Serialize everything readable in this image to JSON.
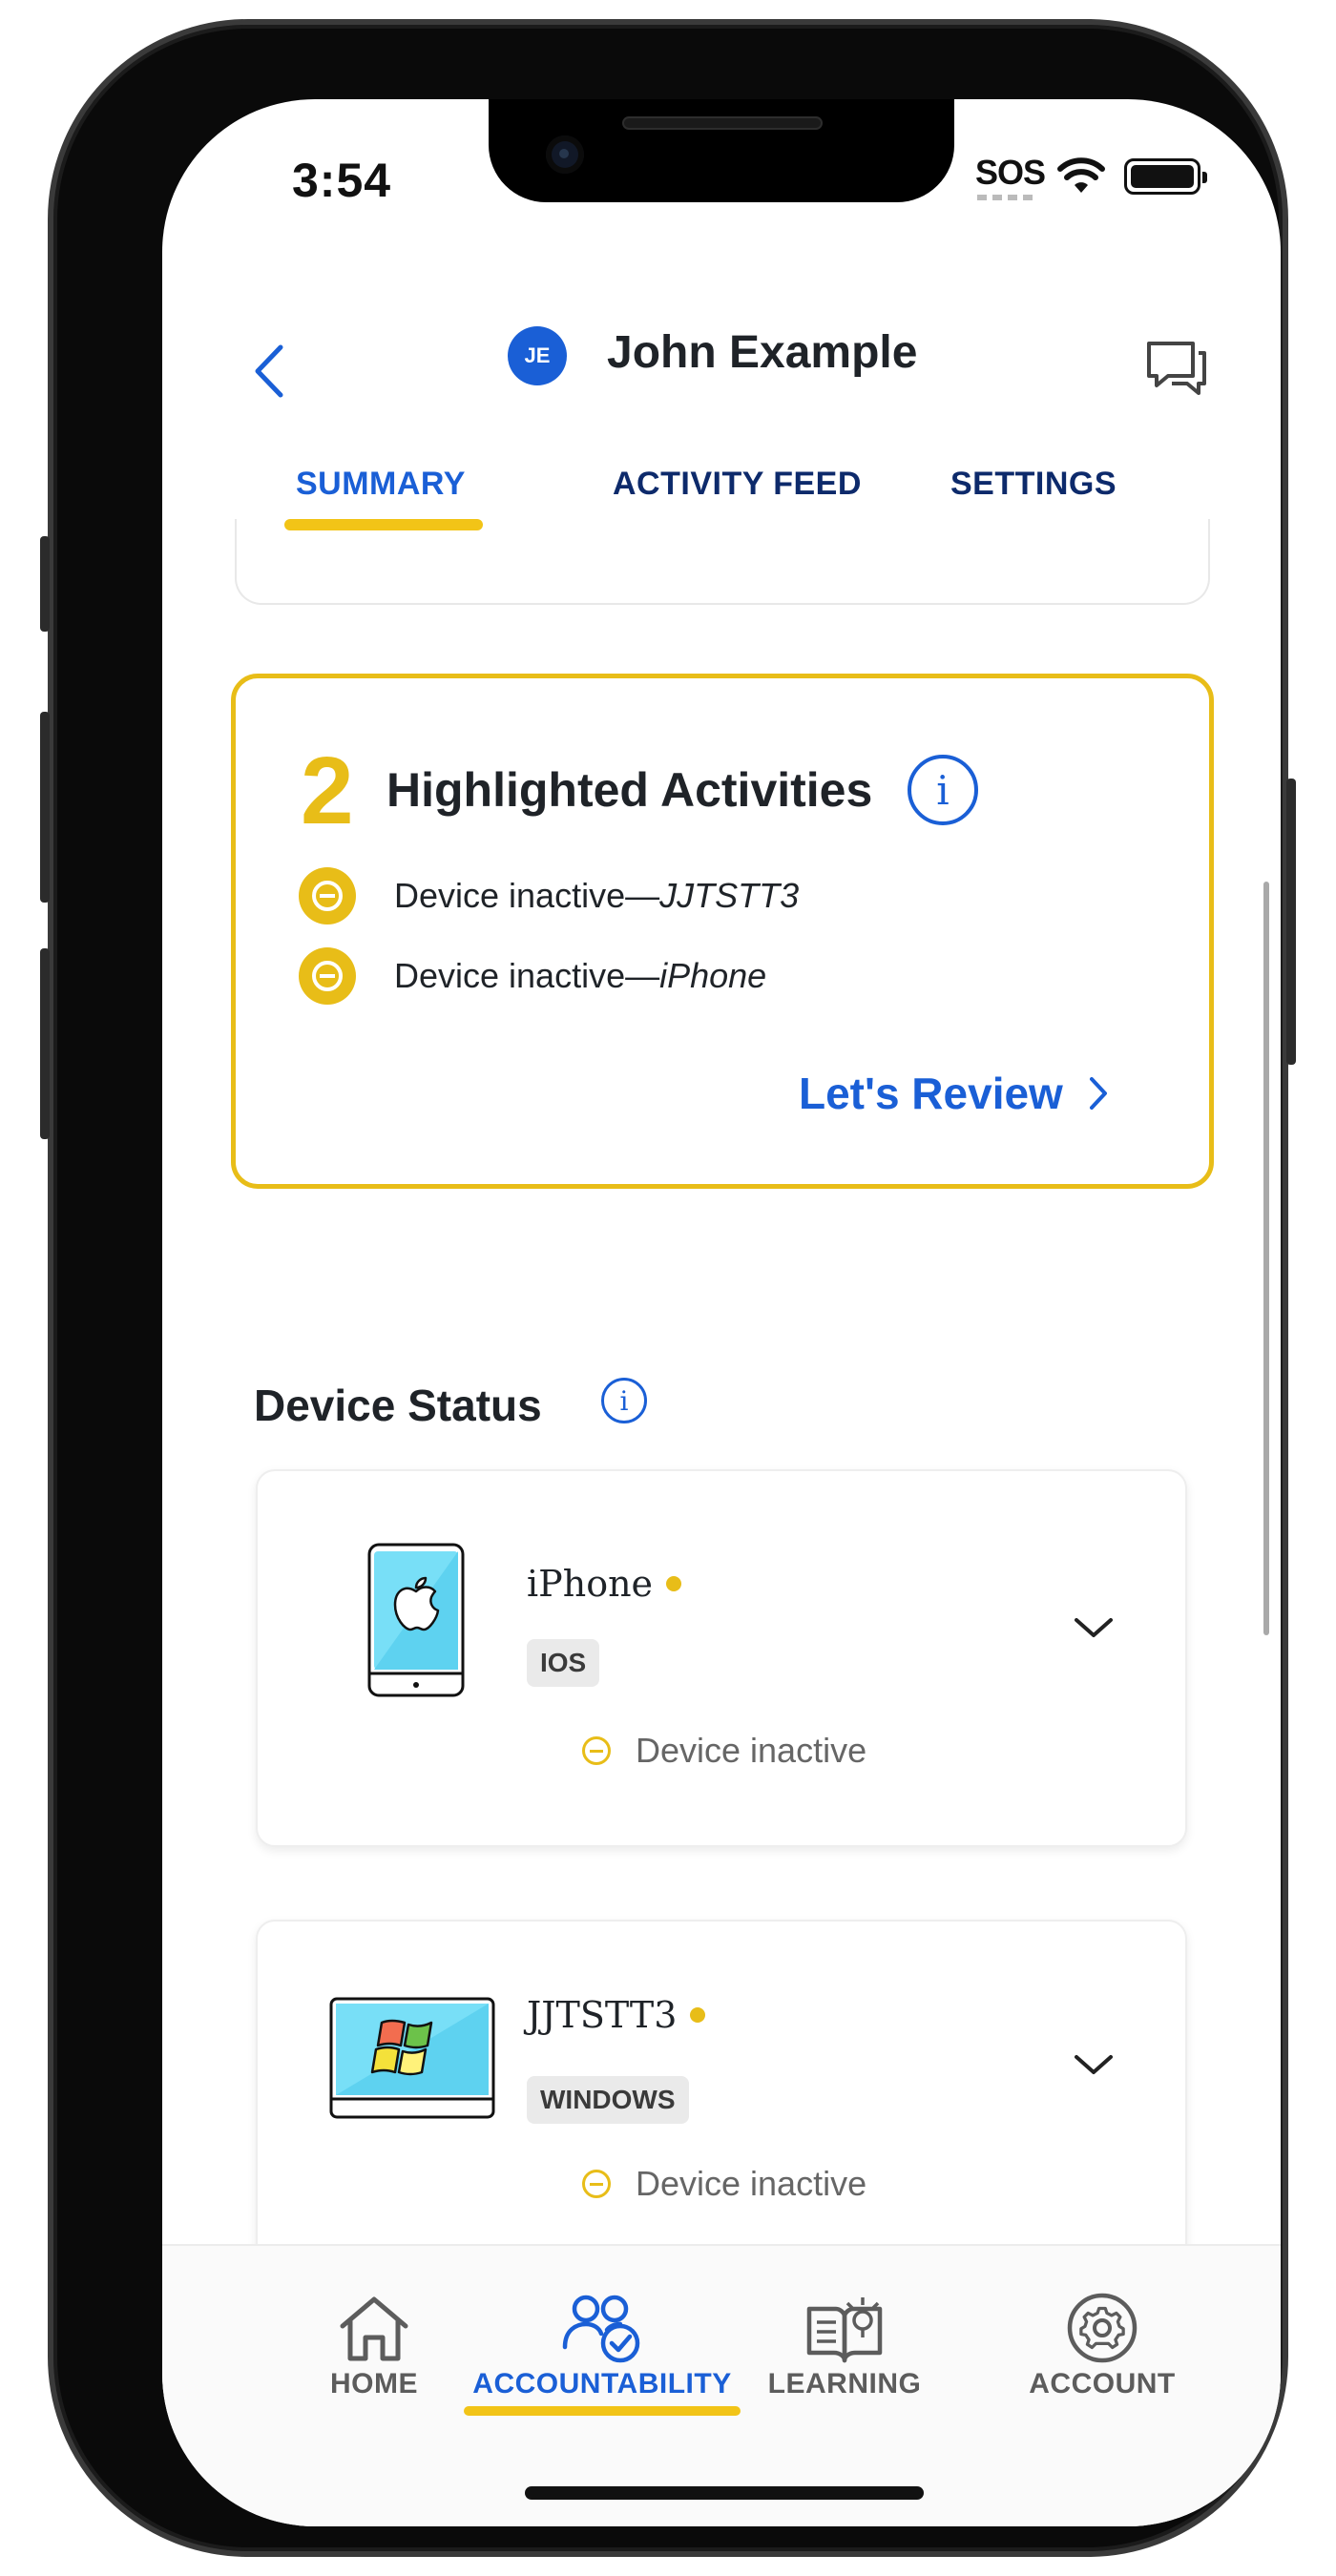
{
  "status_bar": {
    "time": "3:54",
    "sos": "SOS"
  },
  "header": {
    "avatar_initials": "JE",
    "user_name": "John Example"
  },
  "tabs": [
    {
      "label": "SUMMARY",
      "active": true
    },
    {
      "label": "ACTIVITY FEED",
      "active": false
    },
    {
      "label": "SETTINGS",
      "active": false
    }
  ],
  "highlights": {
    "count": "2",
    "title": "Highlighted Activities",
    "items": [
      {
        "prefix": "Device inactive—",
        "device": "JJTSTT3"
      },
      {
        "prefix": "Device inactive—",
        "device": "iPhone"
      }
    ],
    "review_label": "Let's Review"
  },
  "device_status": {
    "title": "Device Status",
    "devices": [
      {
        "name": "iPhone",
        "os": "IOS",
        "status": "Device inactive"
      },
      {
        "name": "JJTSTT3",
        "os": "WINDOWS",
        "status": "Device inactive"
      }
    ]
  },
  "bottom_nav": [
    {
      "label": "HOME",
      "icon": "home-icon",
      "active": false
    },
    {
      "label": "ACCOUNTABILITY",
      "icon": "accountability-icon",
      "active": true
    },
    {
      "label": "LEARNING",
      "icon": "learning-icon",
      "active": false
    },
    {
      "label": "ACCOUNT",
      "icon": "gear-icon",
      "active": false
    }
  ],
  "colors": {
    "accent_blue": "#1a5fd6",
    "accent_yellow": "#e8bd18",
    "nav_text": "#0d2a6b"
  }
}
